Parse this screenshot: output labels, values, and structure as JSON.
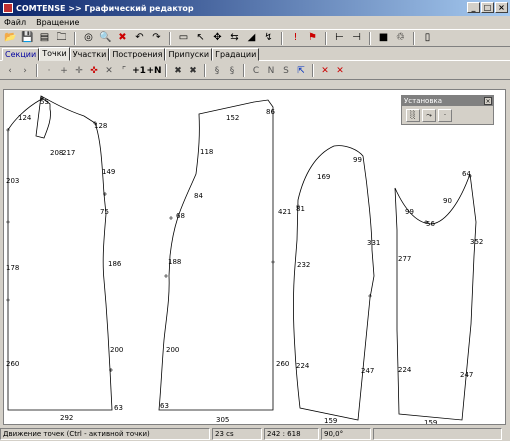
{
  "window": {
    "title": "COMTENSE >> Графический редактор"
  },
  "menu": [
    "Файл",
    "Вращение"
  ],
  "toolbar1": [
    "open-icon",
    "save-icon",
    "save-as-icon",
    "folder-icon",
    "target-icon",
    "zoom-icon",
    "delete-icon",
    "undo-icon",
    "redo-icon",
    "select-icon",
    "pointer-icon",
    "move-icon",
    "mirror-icon",
    "measure-icon",
    "rotate-icon",
    "flag-icon",
    "marker-icon",
    "segment-icon",
    "line-icon",
    "fill-icon",
    "recycle-icon",
    "exit-icon"
  ],
  "tabs": [
    "Секции",
    "Точки",
    "Участки",
    "Построения",
    "Припуски",
    "Градации"
  ],
  "active_tab": 1,
  "toolbar2": [
    "‹",
    "›",
    "·",
    "+",
    "✛",
    "✜",
    "✕",
    "⌜",
    "+1",
    "+N",
    "✖",
    "✖",
    "§",
    "§",
    "C",
    "N",
    "S",
    "⇱",
    "✕",
    "✕"
  ],
  "float_panel": {
    "title": "Установка",
    "buttons": [
      "░",
      "⤳",
      "·"
    ]
  },
  "labels": {
    "p1": [
      "55",
      "124",
      "203",
      "178",
      "260",
      "292",
      "208",
      "217",
      "128",
      "149",
      "75",
      "186",
      "200",
      "63"
    ],
    "p2": [
      "152",
      "86",
      "118",
      "84",
      "68",
      "188",
      "200",
      "63",
      "305",
      "421",
      "260"
    ],
    "p3": [
      "99",
      "169",
      "81",
      "232",
      "224",
      "159",
      "331",
      "247"
    ],
    "p4": [
      "64",
      "99",
      "56",
      "90",
      "277",
      "352",
      "224",
      "247",
      "159"
    ]
  },
  "status": [
    "Движение точек (Ctrl - активной точки)",
    "23 cs",
    "242 : 618",
    "90,0°"
  ]
}
